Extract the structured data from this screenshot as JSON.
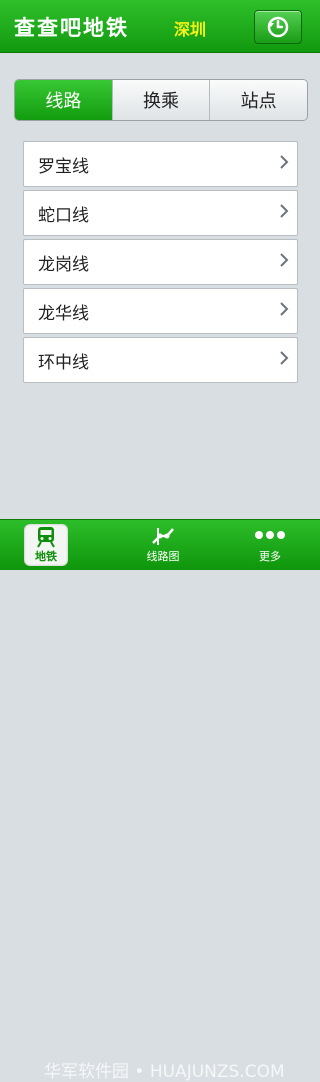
{
  "header": {
    "title": "查查吧地铁",
    "city": "深圳"
  },
  "tabs": [
    {
      "label": "线路",
      "active": true
    },
    {
      "label": "换乘",
      "active": false
    },
    {
      "label": "站点",
      "active": false
    }
  ],
  "lines": [
    "罗宝线",
    "蛇口线",
    "龙岗线",
    "龙华线",
    "环中线"
  ],
  "tabbar": {
    "metro_label": "地铁",
    "map_label": "线路图",
    "more_label": "更多"
  },
  "watermark": "华军软件园 • HUAJUNZS.COM",
  "colors": {
    "primary_green": "#12990f",
    "city_yellow": "#f6f218"
  }
}
